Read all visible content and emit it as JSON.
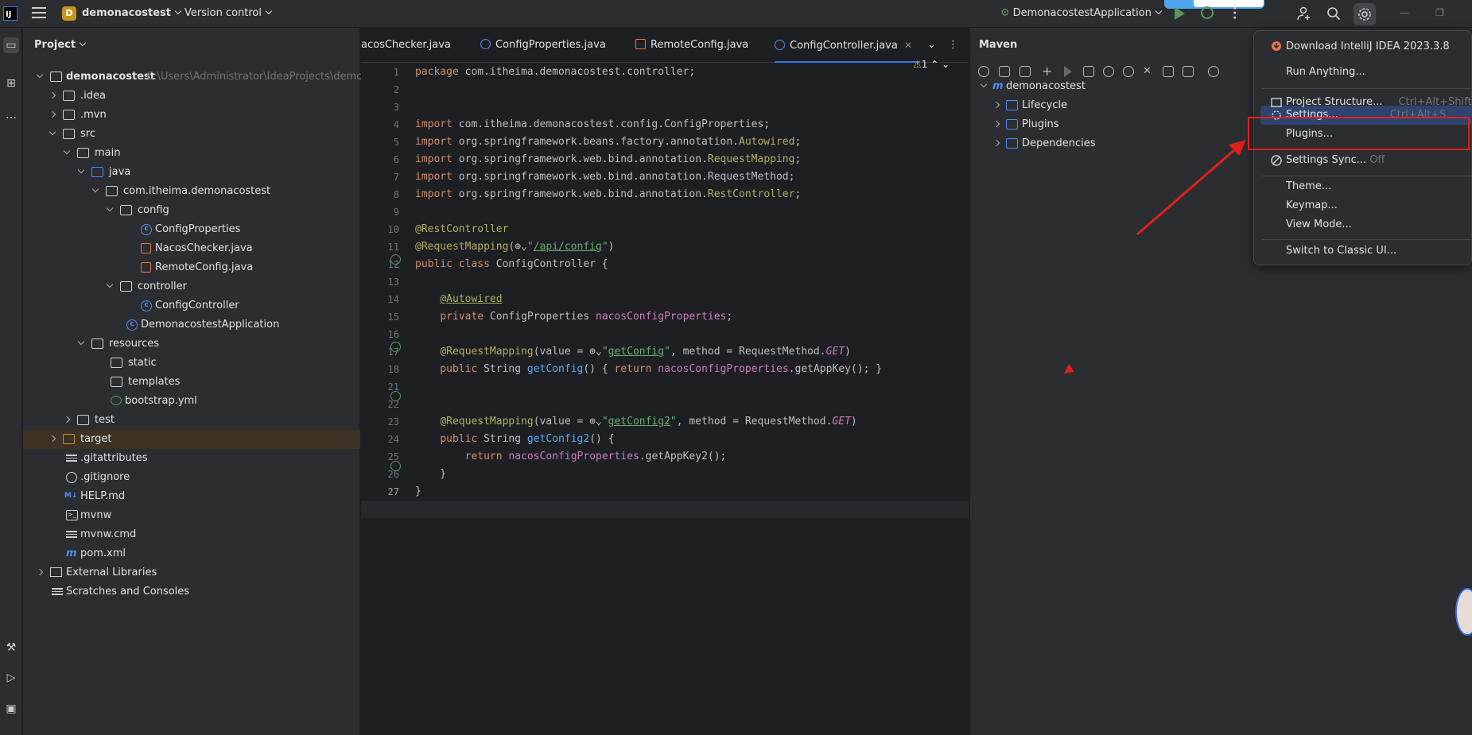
{
  "topbar": {
    "logo": "IJ",
    "project_badge": "D",
    "project_name": "demonacostest",
    "vcs_label": "Version control",
    "run_config": "DemonacostestApplication"
  },
  "project_panel": {
    "title": "Project",
    "tree": [
      {
        "label": "demonacostest",
        "path": "C:\\Users\\Administrator\\IdeaProjects\\demon",
        "bold": true
      },
      {
        "label": ".idea"
      },
      {
        "label": ".mvn"
      },
      {
        "label": "src"
      },
      {
        "label": "main"
      },
      {
        "label": "java"
      },
      {
        "label": "com.itheima.demonacostest"
      },
      {
        "label": "config"
      },
      {
        "label": "ConfigProperties"
      },
      {
        "label": "NacosChecker.java"
      },
      {
        "label": "RemoteConfig.java"
      },
      {
        "label": "controller"
      },
      {
        "label": "ConfigController"
      },
      {
        "label": "DemonacostestApplication"
      },
      {
        "label": "resources"
      },
      {
        "label": "static"
      },
      {
        "label": "templates"
      },
      {
        "label": "bootstrap.yml"
      },
      {
        "label": "test"
      },
      {
        "label": "target"
      },
      {
        "label": ".gitattributes"
      },
      {
        "label": ".gitignore"
      },
      {
        "label": "HELP.md"
      },
      {
        "label": "mvnw"
      },
      {
        "label": "mvnw.cmd"
      },
      {
        "label": "pom.xml"
      },
      {
        "label": "External Libraries"
      },
      {
        "label": "Scratches and Consoles"
      }
    ]
  },
  "editor": {
    "tabs": [
      {
        "label": "acosChecker.java"
      },
      {
        "label": "ConfigProperties.java"
      },
      {
        "label": "RemoteConfig.java"
      },
      {
        "label": "ConfigController.java"
      }
    ],
    "warning_count": "1",
    "line_numbers": [
      "1",
      "2",
      "3",
      "4",
      "5",
      "6",
      "7",
      "8",
      "9",
      "10",
      "11",
      "12",
      "13",
      "14",
      "15",
      "16",
      "17",
      "18",
      "21",
      "22",
      "23",
      "24",
      "25",
      "26",
      "27"
    ]
  },
  "maven": {
    "title": "Maven",
    "tree": [
      {
        "label": "demonacostest"
      },
      {
        "label": "Lifecycle"
      },
      {
        "label": "Plugins"
      },
      {
        "label": "Dependencies"
      }
    ]
  },
  "popup_menu": {
    "items": [
      {
        "label": "Download IntelliJ IDEA 2023.3.8",
        "shortcut": ""
      },
      {
        "label": "Run Anything...",
        "shortcut": ""
      },
      {
        "label": "Project Structure...",
        "shortcut": "Ctrl+Alt+Shift+S"
      },
      {
        "label": "Settings...",
        "shortcut": "Ctrl+Alt+S"
      },
      {
        "label": "Plugins...",
        "shortcut": ""
      },
      {
        "label": "Settings Sync...",
        "shortcut": "Off"
      },
      {
        "label": "Theme...",
        "shortcut": ""
      },
      {
        "label": "Keymap...",
        "shortcut": ""
      },
      {
        "label": "View Mode...",
        "shortcut": ""
      },
      {
        "label": "Switch to Classic UI...",
        "shortcut": ""
      }
    ]
  },
  "colors": {
    "accent": "#3574f0",
    "highlight_box": "#e0201c",
    "run_green": "#57965c"
  }
}
